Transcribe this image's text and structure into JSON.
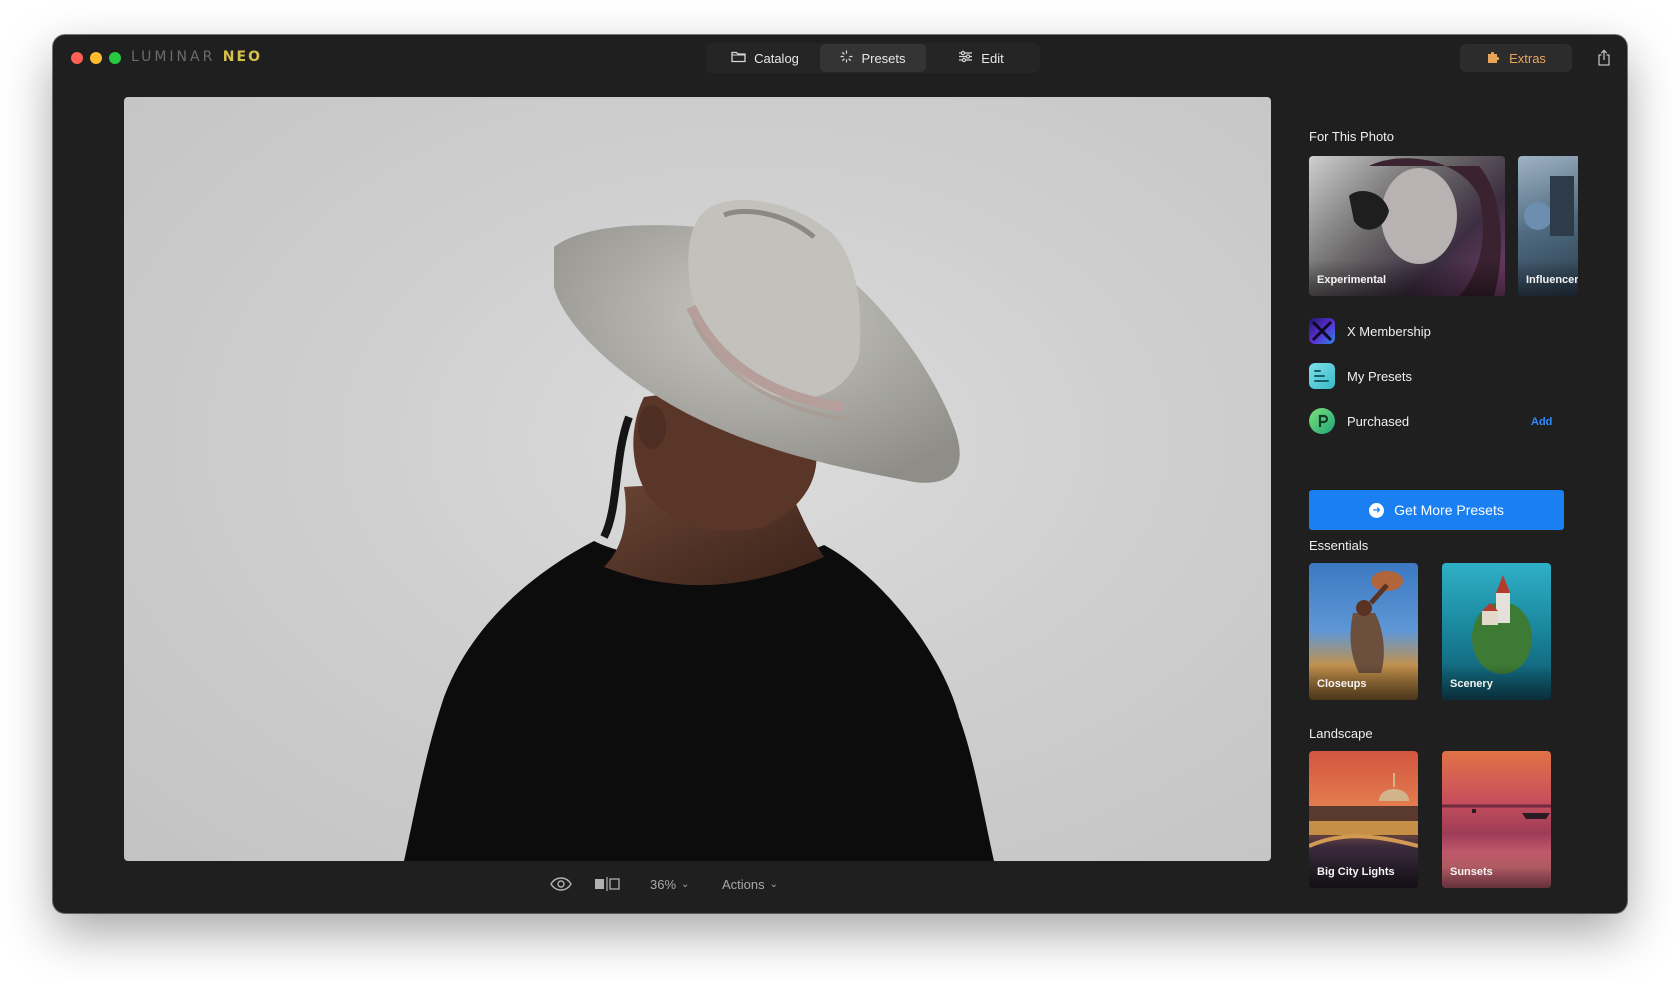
{
  "app": {
    "logo_part1": "LUMINAR",
    "logo_part2": "NEO"
  },
  "toolbar": {
    "tabs": [
      {
        "label": "Catalog",
        "icon": "folder-icon"
      },
      {
        "label": "Presets",
        "icon": "sparkle-icon",
        "active": true
      },
      {
        "label": "Edit",
        "icon": "sliders-icon"
      }
    ],
    "extras_label": "Extras",
    "extras_icon": "puzzle-icon",
    "share_icon": "share-icon"
  },
  "bottom": {
    "zoom": "36%",
    "actions_label": "Actions",
    "eye_icon": "eye-icon",
    "compare_icon": "compare-icon"
  },
  "panel": {
    "for_this_photo_title": "For This Photo",
    "for_this_photo": [
      {
        "label": "Experimental"
      },
      {
        "label": "Influencer"
      }
    ],
    "menu": [
      {
        "label": "X Membership",
        "icon": "x-membership-icon"
      },
      {
        "label": "My Presets",
        "icon": "my-presets-icon"
      },
      {
        "label": "Purchased",
        "icon": "purchased-icon"
      }
    ],
    "add_label": "Add",
    "get_more_label": "Get More Presets",
    "essentials_title": "Essentials",
    "essentials": [
      {
        "label": "Closeups"
      },
      {
        "label": "Scenery"
      }
    ],
    "landscape_title": "Landscape",
    "landscape": [
      {
        "label": "Big City Lights"
      },
      {
        "label": "Sunsets"
      }
    ]
  },
  "colors": {
    "accent": "#1a7ff0",
    "extras": "#e8a55a",
    "add_link": "#2f8bff"
  }
}
